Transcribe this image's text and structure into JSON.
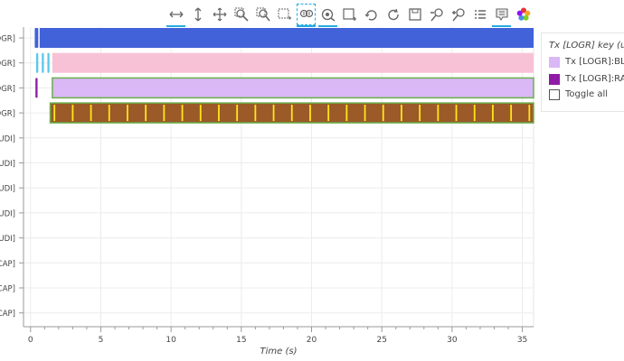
{
  "toolbar": {
    "tools": [
      {
        "name": "xpan-tool-icon",
        "active": true
      },
      {
        "name": "ypan-tool-icon",
        "active": false
      },
      {
        "name": "pan-tool-icon",
        "active": false
      },
      {
        "name": "zoom-in-box-icon",
        "active": false
      },
      {
        "name": "zoom-out-box-icon",
        "active": false
      },
      {
        "name": "box-select-icon",
        "active": false
      },
      {
        "name": "wheel-zoom-icon",
        "active": true,
        "dashed": true
      },
      {
        "name": "reset-zoom-icon",
        "active": true
      },
      {
        "name": "box-add-icon",
        "active": false
      },
      {
        "name": "undo-icon",
        "active": false
      },
      {
        "name": "redo-icon",
        "active": false
      },
      {
        "name": "save-icon",
        "active": false
      },
      {
        "name": "zoom-out-icon",
        "active": false
      },
      {
        "name": "zoom-in-icon",
        "active": false
      },
      {
        "name": "legend-list-icon",
        "active": false
      },
      {
        "name": "hover-tooltip-icon",
        "active": true
      },
      {
        "name": "bokeh-logo-icon",
        "active": false
      }
    ]
  },
  "legend": {
    "title": "Tx [LOGR] key (us",
    "items": [
      {
        "label": "Tx [LOGR]:BL",
        "color": "#d9b8f5"
      },
      {
        "label": "Tx [LOGR]:RA",
        "color": "#8e1aa6"
      }
    ],
    "toggle_label": "Toggle all"
  },
  "chart_data": {
    "type": "timeline",
    "xlabel": "Time (s)",
    "ylabel": "",
    "xlim": [
      -0.5,
      35.8
    ],
    "xticks": [
      0,
      5,
      10,
      15,
      20,
      25,
      30,
      35
    ],
    "grid": true,
    "legend_position": "right",
    "rows": [
      {
        "label": "OGR]",
        "bars": [
          {
            "start": 0.3,
            "end": 0.55,
            "color": "#4162d9"
          },
          {
            "start": 0.65,
            "end": 35.8,
            "color": "#4162d9"
          }
        ]
      },
      {
        "label": "OGR]",
        "bars": [
          {
            "start": 0.4,
            "end": 0.55,
            "color": "#5bc8e8"
          },
          {
            "start": 0.8,
            "end": 0.95,
            "color": "#5bc8e8"
          },
          {
            "start": 1.2,
            "end": 1.35,
            "color": "#5bc8e8"
          },
          {
            "start": 1.55,
            "end": 35.8,
            "color": "#f8c2d6"
          }
        ]
      },
      {
        "label": "OGR]",
        "bars": [
          {
            "start": 0.35,
            "end": 0.5,
            "color": "#8e1aa6"
          },
          {
            "start": 1.55,
            "end": 35.8,
            "color": "#d9b8f5",
            "outline": "#6ab04c"
          }
        ]
      },
      {
        "label": "OGR]",
        "bars": [
          {
            "start": 1.4,
            "end": 35.8,
            "color": "#9b5a28",
            "outline": "#6ab04c",
            "stripes": "#ffe619",
            "stripe_step": 1.3
          }
        ]
      },
      {
        "label": "UDI]",
        "bars": []
      },
      {
        "label": "UDI]",
        "bars": []
      },
      {
        "label": "UDI]",
        "bars": []
      },
      {
        "label": "UDI]",
        "bars": []
      },
      {
        "label": "UDI]",
        "bars": []
      },
      {
        "label": "CAP]",
        "bars": []
      },
      {
        "label": "CAP]",
        "bars": []
      },
      {
        "label": "CAP]",
        "bars": []
      }
    ]
  }
}
